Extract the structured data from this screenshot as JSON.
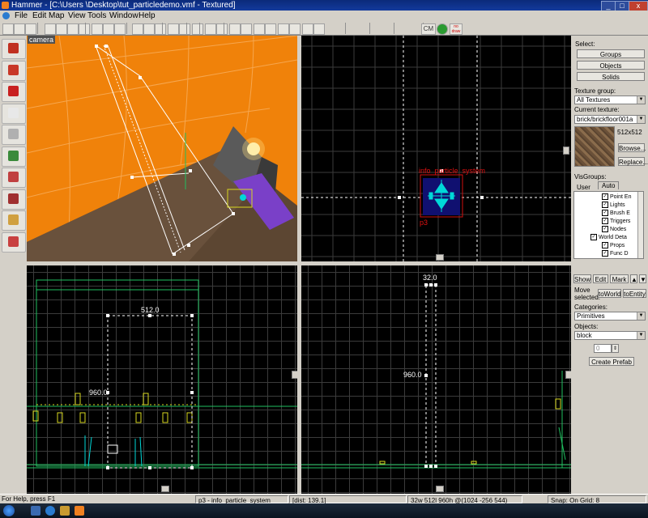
{
  "window": {
    "title": "Hammer - [C:\\Users              \\Desktop\\tut_particledemo.vmf - Textured]",
    "minimize": "_",
    "maximize": "□",
    "close": "x"
  },
  "menu": [
    "File",
    "Edit",
    "Map",
    "View",
    "Tools",
    "Window",
    "Help"
  ],
  "toolbar": {
    "icons": [
      "grid-icon",
      "grid-smaller-icon",
      "grid-larger-icon",
      "undo-icon",
      "redo-icon",
      "group-icon",
      "ungroup-icon",
      "hide-icon",
      "unhide-icon",
      "cut-icon",
      "copy-icon",
      "paste-icon",
      "snap-icon",
      "texture-lock-icon",
      "carve-icon",
      "toggle-3d-grid-icon",
      "selection-icon",
      "cordon-icon",
      "flip-icon",
      "vertex-icon",
      "models-icon",
      "entity-report-icon",
      "check-problems-icon",
      "run-map-icon",
      "texture-icon",
      "move-icon"
    ],
    "cm_label": "CM",
    "no_draw_label": "no draw"
  },
  "left_tools": [
    "selection-tool-icon",
    "magnify-tool-icon",
    "camera-tool-icon",
    "entity-tool-icon",
    "block-tool-icon",
    "texture-tool-icon",
    "apply-decals-icon",
    "overlay-tool-icon",
    "clipping-tool-icon",
    "vertex-tool-icon"
  ],
  "viewports": {
    "camera": {
      "label": "camera"
    },
    "top": {
      "entity_label": "info_particle_system",
      "name_label": "p3"
    },
    "front": {
      "width_label": "512.0",
      "height_label": "960.0"
    },
    "side": {
      "width_label": "32.0",
      "height_label": "960.0"
    }
  },
  "right_panel": {
    "select_label": "Select:",
    "select_buttons": [
      "Groups",
      "Objects",
      "Solids"
    ],
    "texture_group_label": "Texture group:",
    "texture_group_value": "All Textures",
    "current_texture_label": "Current texture:",
    "current_texture_value": "brick/brickfloor001a",
    "texture_size": "512x512",
    "browse_button": "Browse...",
    "replace_button": "Replace...",
    "visgroups_label": "VisGroups:",
    "visgroup_tabs": [
      "User",
      "Auto"
    ],
    "visgroup_items": [
      {
        "label": "Point En",
        "indent": 2,
        "checked": true
      },
      {
        "label": "Lights",
        "indent": 2,
        "checked": true
      },
      {
        "label": "Brush E",
        "indent": 2,
        "checked": true
      },
      {
        "label": "Triggers",
        "indent": 2,
        "checked": true
      },
      {
        "label": "Nodes",
        "indent": 2,
        "checked": true
      },
      {
        "label": "World Deta",
        "indent": 1,
        "checked": true
      },
      {
        "label": "Props",
        "indent": 2,
        "checked": true
      },
      {
        "label": "Func D",
        "indent": 2,
        "checked": true
      }
    ],
    "show_button": "Show",
    "edit_button": "Edit",
    "mark_button": "Mark",
    "move_selected_label": "Move selected:",
    "to_world_button": "toWorld",
    "to_entity_button": "toEntity",
    "categories_label": "Categories:",
    "categories_value": "Primitives",
    "objects_label": "Objects:",
    "objects_value": "block",
    "faces_value": "0",
    "create_prefab_button": "Create Prefab"
  },
  "status": {
    "help": "For Help, press F1",
    "selection": "p3 - info_particle_system",
    "dist": "[dist: 139.1]",
    "size": "32w 512l 960h @(1024 -256 544)",
    "snap": "Snap: On Grid: 8"
  },
  "colors": {
    "orange_sky": "#f0820a",
    "grid": "#3b3b3b",
    "selection": "#ffffff",
    "entity": "#00d8d8",
    "red_label": "#e01010",
    "brush_yellow": "#d8d820",
    "brush_green": "#20c060"
  }
}
